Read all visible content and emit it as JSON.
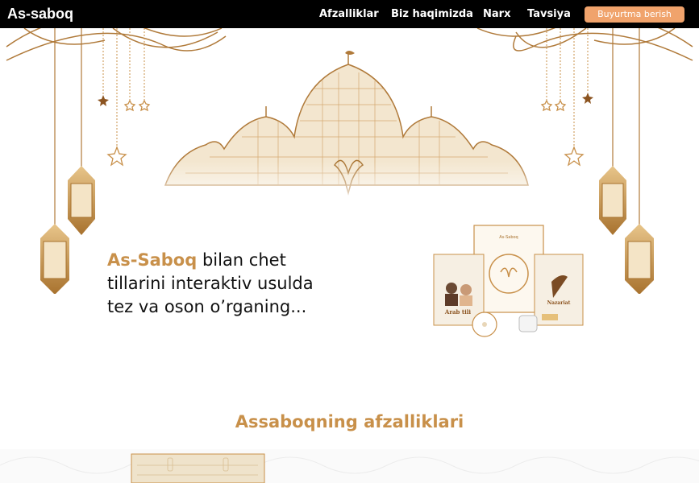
{
  "nav": {
    "brand": "As-saboq",
    "links": [
      "Afzalliklar",
      "Biz haqimizda",
      "Narx",
      "Tavsiya"
    ],
    "order_button": "Buyurtma berish"
  },
  "hero": {
    "headline_accent": "As-Saboq",
    "headline_rest_1": " bilan chet",
    "headline_line2": "tillarini interaktiv usulda",
    "headline_line3": "tez va oson o’rganing..."
  },
  "product": {
    "box_brand": "As-Saboq",
    "box_left_title": "Arab tili",
    "box_right_title": "Nazariat"
  },
  "section": {
    "title": "Assaboqning afzalliklari"
  },
  "colors": {
    "gold": "#c8904a",
    "button": "#f0a36c",
    "nav_bg": "#000000"
  }
}
